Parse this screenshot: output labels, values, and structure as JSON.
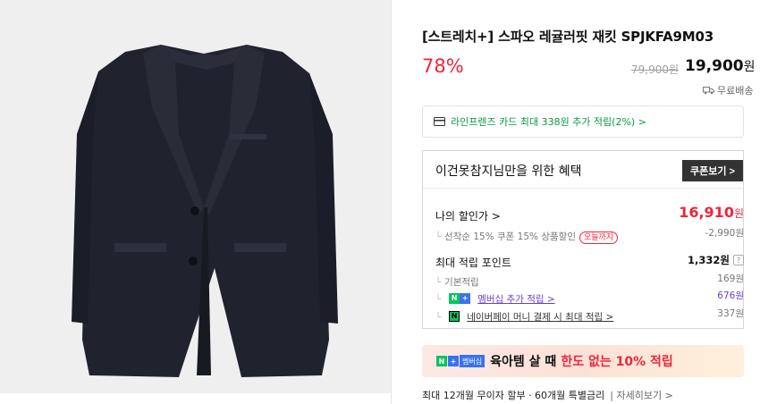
{
  "product": {
    "title": "[스트레치+] 스파오 레귤러핏 재킷 SPJKFA9M03",
    "discount_rate": "78%",
    "original_price": "79,900원",
    "sale_price": "19,900",
    "sale_price_unit": "원",
    "shipping": "무료배송"
  },
  "card_promo": {
    "text": "라인프렌즈 카드 최대 338원 추가 적립(2%) >"
  },
  "benefits": {
    "title": "이건못참지님만을 위한 혜택",
    "coupon_button": "쿠폰보기 >",
    "my_price_label": "나의 할인가 >",
    "my_price_value": "16,910",
    "my_price_unit": "원",
    "coupon_line": "선착순 15% 쿠폰 15% 상품할인",
    "coupon_tag": "오늘까지",
    "coupon_value": "-2,990원",
    "points_label": "최대 적립 포인트",
    "points_value": "1,332원",
    "help_icon_text": "?",
    "basic_label": "기본적립",
    "basic_value": "169원",
    "membership_label": "멤버십 추가 적립 >",
    "membership_value": "676원",
    "naverpay_label": "네이버페이 머니 결제 시 최대 적립 >",
    "naverpay_value": "337원",
    "badge_n": "N",
    "badge_plus": "+"
  },
  "banner": {
    "badge_label": "멤버십",
    "text_main": "육아템 살 때 ",
    "text_emphasis": "한도 없는 10% 적립"
  },
  "installment": {
    "text": "최대 12개월 무이자 할부 · 60개월 특별금리",
    "link": "| 자세히보기 >"
  },
  "icons": {
    "shipping": "truck-icon",
    "card": "credit-card-icon",
    "help": "help-circle-icon"
  },
  "colors": {
    "accent_red": "#f0243c",
    "naver_green": "#03c75a",
    "membership_purple": "#6b3fd1"
  }
}
